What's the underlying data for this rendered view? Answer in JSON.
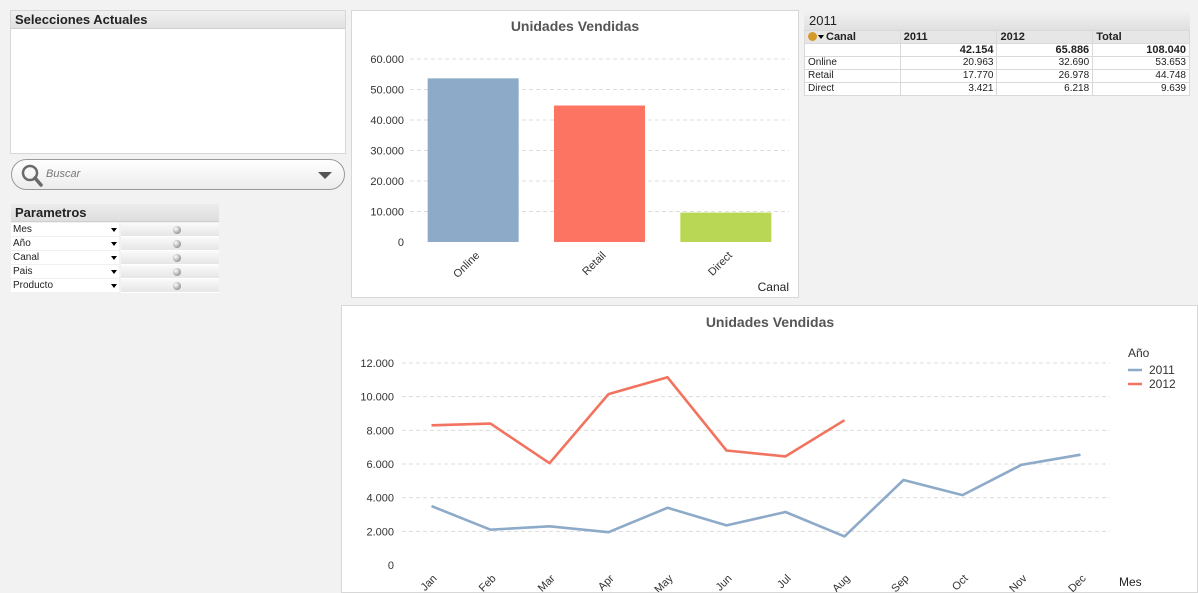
{
  "current_selections": {
    "title": "Selecciones Actuales"
  },
  "search": {
    "placeholder": "Buscar"
  },
  "params": {
    "title": "Parametros",
    "items": [
      "Mes",
      "Año",
      "Canal",
      "Pais",
      "Producto"
    ]
  },
  "table": {
    "title": "2011",
    "headers": [
      "Canal",
      "2011",
      "2012",
      "Total"
    ],
    "totals": [
      "",
      "42.154",
      "65.886",
      "108.040"
    ],
    "rows": [
      [
        "Online",
        "20.963",
        "32.690",
        "53.653"
      ],
      [
        "Retail",
        "17.770",
        "26.978",
        "44.748"
      ],
      [
        "Direct",
        "3.421",
        "6.218",
        "9.639"
      ]
    ]
  },
  "colors": {
    "series_2011": "#8eaac9",
    "series_2012": "#f2735f",
    "bar_online": "#8eaac9",
    "bar_retail": "#fd7462",
    "bar_direct": "#bad655"
  },
  "chart_data": [
    {
      "type": "bar",
      "title": "Unidades Vendidas",
      "xlabel": "Canal",
      "ylabel": "",
      "categories": [
        "Online",
        "Retail",
        "Direct"
      ],
      "values": [
        53653,
        44748,
        9639
      ],
      "ylim": [
        0,
        60000
      ],
      "yticks": [
        "0",
        "10.000",
        "20.000",
        "30.000",
        "40.000",
        "50.000",
        "60.000"
      ],
      "grid": true
    },
    {
      "type": "line",
      "title": "Unidades Vendidas",
      "xlabel": "Mes",
      "legend_title": "Año",
      "legend_position": "top-right",
      "categories": [
        "Jan",
        "Feb",
        "Mar",
        "Apr",
        "May",
        "Jun",
        "Jul",
        "Aug",
        "Sep",
        "Oct",
        "Nov",
        "Dec"
      ],
      "ylim": [
        0,
        12000
      ],
      "yticks": [
        "0",
        "2.000",
        "4.000",
        "6.000",
        "8.000",
        "10.000",
        "12.000"
      ],
      "grid": true,
      "series": [
        {
          "name": "2011",
          "values": [
            3500,
            2100,
            2300,
            1950,
            3400,
            2350,
            3150,
            1700,
            5050,
            4150,
            5950,
            6550
          ]
        },
        {
          "name": "2012",
          "values": [
            8300,
            8400,
            6050,
            10150,
            11150,
            6800,
            6450,
            8600,
            null,
            null,
            null,
            null
          ]
        }
      ]
    }
  ]
}
